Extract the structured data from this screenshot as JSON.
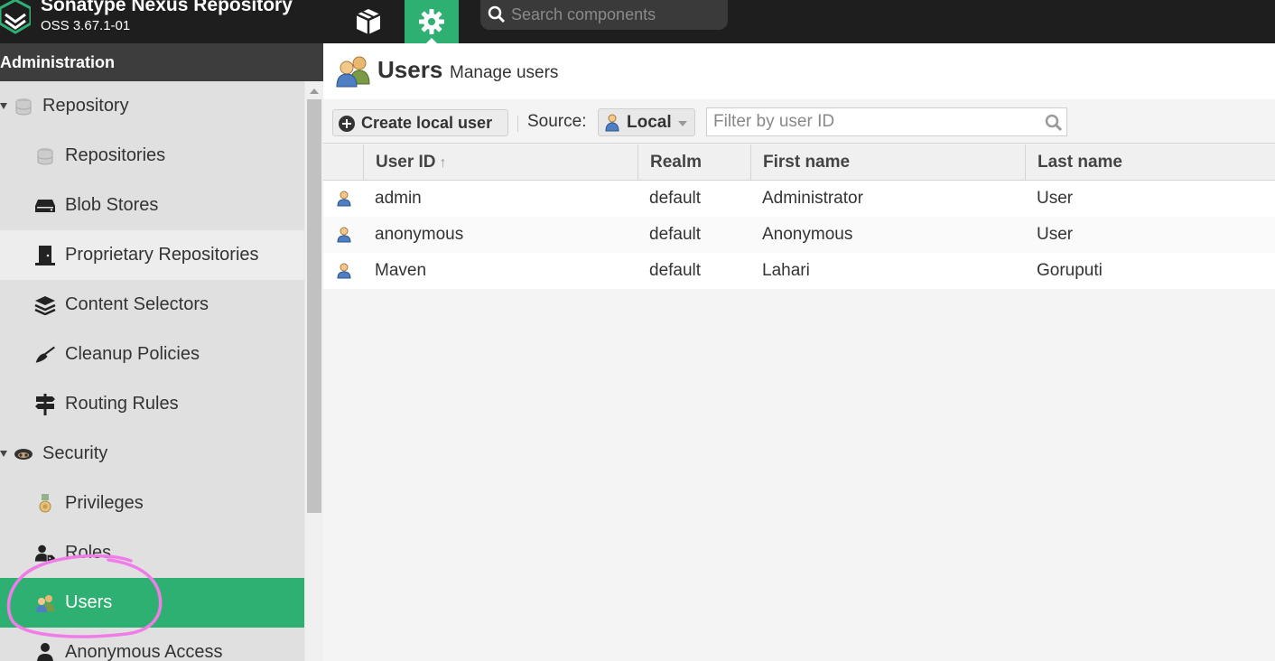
{
  "app": {
    "title": "Sonatype Nexus Repository",
    "version": "OSS 3.67.1-01"
  },
  "topbar": {
    "search_placeholder": "Search components",
    "browse_icon": "cube-icon",
    "admin_icon": "gear-icon"
  },
  "sidebar": {
    "header": "Administration",
    "items": [
      {
        "label": "Repository",
        "icon": "database-icon",
        "level": 1,
        "expanded": true
      },
      {
        "label": "Repositories",
        "icon": "database-icon",
        "level": 2
      },
      {
        "label": "Blob Stores",
        "icon": "hard-drive-icon",
        "level": 2
      },
      {
        "label": "Proprietary Repositories",
        "icon": "door-icon",
        "level": 2
      },
      {
        "label": "Content Selectors",
        "icon": "layers-icon",
        "level": 2
      },
      {
        "label": "Cleanup Policies",
        "icon": "broom-icon",
        "level": 2
      },
      {
        "label": "Routing Rules",
        "icon": "signpost-icon",
        "level": 2
      },
      {
        "label": "Security",
        "icon": "spy-icon",
        "level": 1,
        "expanded": true
      },
      {
        "label": "Privileges",
        "icon": "medal-icon",
        "level": 2
      },
      {
        "label": "Roles",
        "icon": "user-tag-icon",
        "level": 2
      },
      {
        "label": "Users",
        "icon": "users-icon",
        "level": 2,
        "selected": true
      },
      {
        "label": "Anonymous Access",
        "icon": "user-icon",
        "level": 2
      }
    ]
  },
  "page": {
    "title": "Users",
    "subtitle": "Manage users"
  },
  "toolbar": {
    "create_label": "Create local user",
    "source_label": "Source:",
    "source_value": "Local",
    "filter_placeholder": "Filter by user ID"
  },
  "grid": {
    "columns": [
      "User ID",
      "Realm",
      "First name",
      "Last name"
    ],
    "sort_column": "User ID",
    "sort_direction": "asc",
    "rows": [
      {
        "user_id": "admin",
        "realm": "default",
        "first_name": "Administrator",
        "last_name": "User"
      },
      {
        "user_id": "anonymous",
        "realm": "default",
        "first_name": "Anonymous",
        "last_name": "User"
      },
      {
        "user_id": "Maven",
        "realm": "default",
        "first_name": "Lahari",
        "last_name": "Goruputi"
      }
    ]
  },
  "colors": {
    "accent": "#2fb073",
    "topbar": "#1e1e1e",
    "annotation": "#f07ce8"
  }
}
